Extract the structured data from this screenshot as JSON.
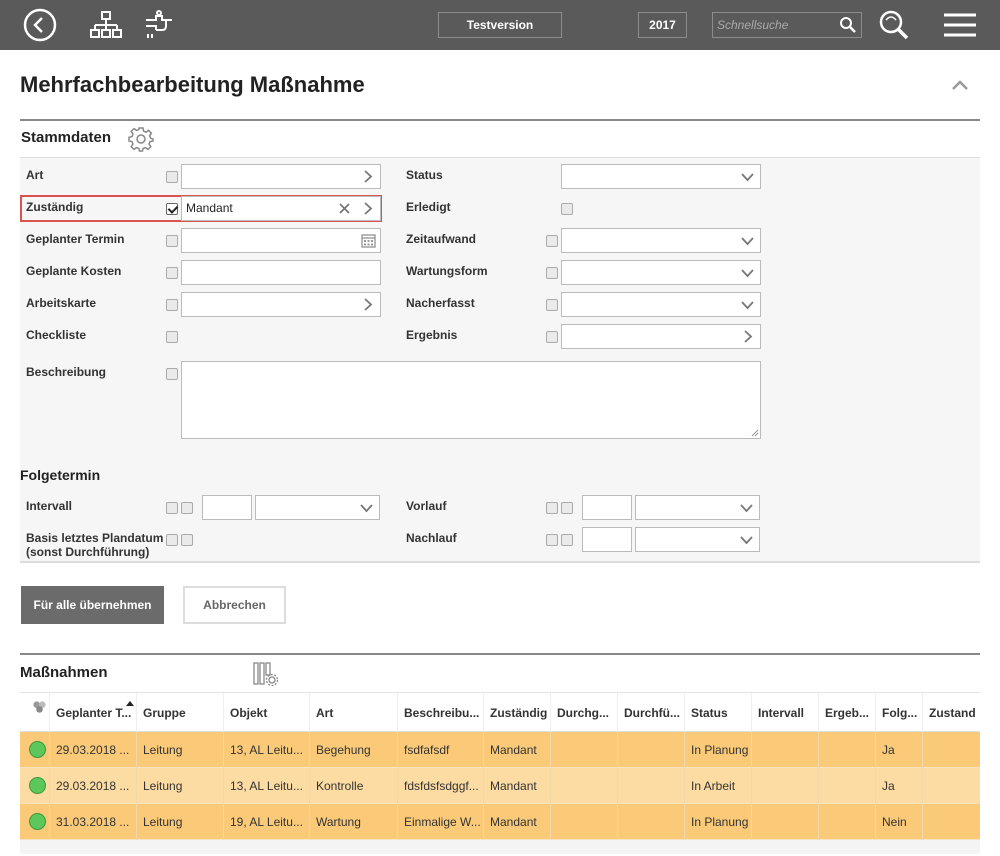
{
  "topbar": {
    "version_label": "Testversion",
    "year_label": "2017",
    "search_placeholder": "Schnellsuche"
  },
  "page": {
    "title": "Mehrfachbearbeitung Maßnahme"
  },
  "stammdaten": {
    "title": "Stammdaten",
    "fields": {
      "art": {
        "label": "Art"
      },
      "status": {
        "label": "Status"
      },
      "zustaendig": {
        "label": "Zuständig",
        "value": "Mandant",
        "checked": true
      },
      "erledigt": {
        "label": "Erledigt"
      },
      "geplanter_termin": {
        "label": "Geplanter Termin"
      },
      "zeitaufwand": {
        "label": "Zeitaufwand"
      },
      "geplante_kosten": {
        "label": "Geplante Kosten"
      },
      "wartungsform": {
        "label": "Wartungsform"
      },
      "arbeitskarte": {
        "label": "Arbeitskarte"
      },
      "nacherfasst": {
        "label": "Nacherfasst"
      },
      "checkliste": {
        "label": "Checkliste"
      },
      "ergebnis": {
        "label": "Ergebnis"
      },
      "beschreibung": {
        "label": "Beschreibung"
      }
    }
  },
  "folgetermin": {
    "title": "Folgetermin",
    "intervall": {
      "label": "Intervall"
    },
    "vorlauf": {
      "label": "Vorlauf"
    },
    "basis": {
      "label_line1": "Basis letztes Plandatum",
      "label_line2": "(sonst Durchführung)"
    },
    "nachlauf": {
      "label": "Nachlauf"
    }
  },
  "actions": {
    "apply_label": "Für alle übernehmen",
    "cancel_label": "Abbrechen"
  },
  "massnahmen": {
    "title": "Maßnahmen",
    "columns": [
      "Geplanter T...",
      "Gruppe",
      "Objekt",
      "Art",
      "Beschreibu...",
      "Zuständig",
      "Durchg...",
      "Durchfü...",
      "Status",
      "Intervall",
      "Ergeb...",
      "Folg...",
      "Zustand"
    ],
    "rows": [
      [
        "29.03.2018 ...",
        "Leitung",
        "13, AL Leitu...",
        "Begehung",
        "fsdfafsdf",
        "Mandant",
        "",
        "",
        "In Planung",
        "",
        "",
        "Ja",
        ""
      ],
      [
        "29.03.2018 ...",
        "Leitung",
        "13, AL Leitu...",
        "Kontrolle",
        "fdsfdsfsdggf...",
        "Mandant",
        "",
        "",
        "In Arbeit",
        "",
        "",
        "Ja",
        ""
      ],
      [
        "31.03.2018 ...",
        "Leitung",
        "19, AL Leitu...",
        "Wartung",
        "Einmalige W...",
        "Mandant",
        "",
        "",
        "In Planung",
        "",
        "",
        "Nein",
        ""
      ]
    ]
  },
  "colors": {
    "topbar": "#5a5a5a",
    "row_odd": "#fbca78",
    "row_even": "#fddca3",
    "highlight": "#d9534f",
    "status_green": "#5cc85c"
  }
}
